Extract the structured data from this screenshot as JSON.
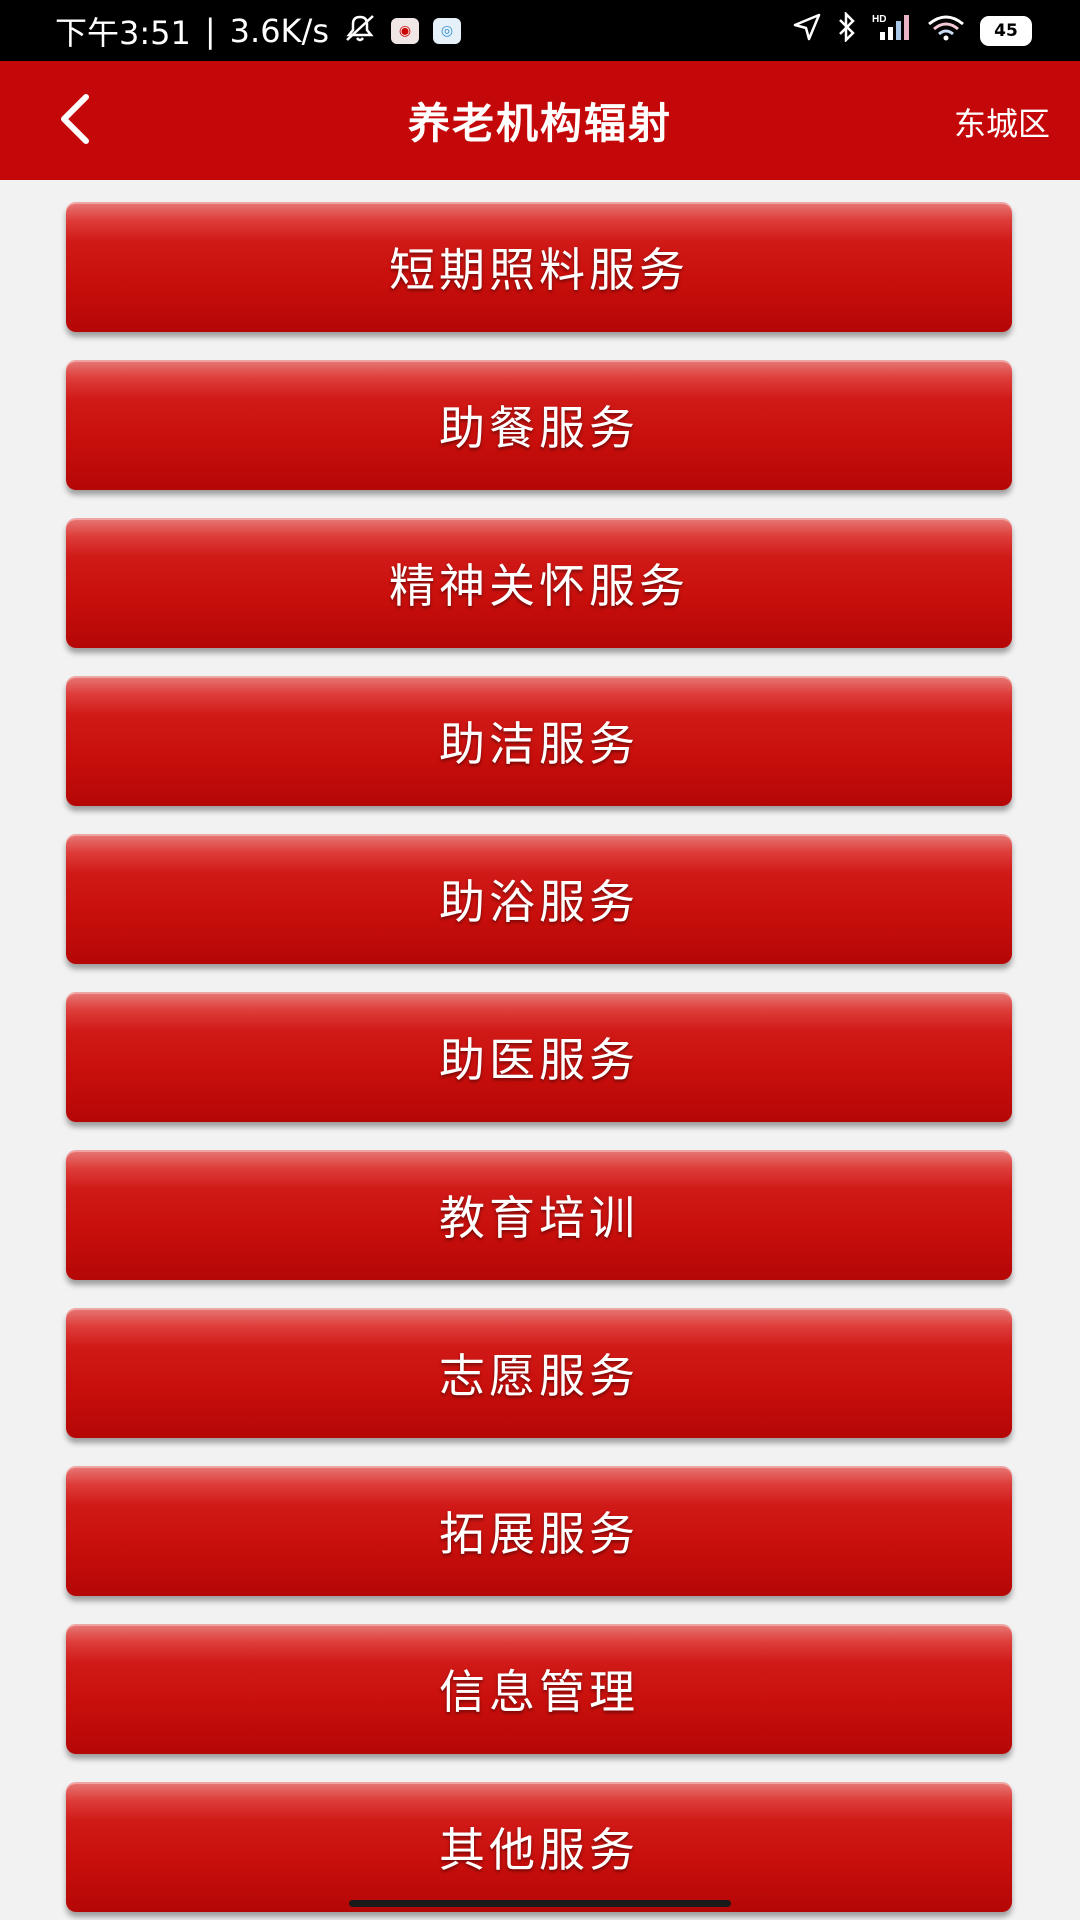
{
  "status_bar": {
    "time": "下午3:51",
    "net_speed": "3.6K/s",
    "battery": "45",
    "icons": [
      "mute-icon",
      "app-notification-icon",
      "app-notification-icon",
      "location-icon",
      "bluetooth-icon",
      "signal-icon",
      "wifi-icon",
      "battery-icon"
    ]
  },
  "header": {
    "title": "养老机构辐射",
    "region": "东城区"
  },
  "menu": [
    {
      "label": "短期照料服务"
    },
    {
      "label": "助餐服务"
    },
    {
      "label": "精神关怀服务"
    },
    {
      "label": "助洁服务"
    },
    {
      "label": "助浴服务"
    },
    {
      "label": "助医服务"
    },
    {
      "label": "教育培训"
    },
    {
      "label": "志愿服务"
    },
    {
      "label": "拓展服务"
    },
    {
      "label": "信息管理"
    },
    {
      "label": "其他服务"
    }
  ],
  "colors": {
    "header_bg": "#c4080a",
    "button_red": "#c90f0c"
  }
}
